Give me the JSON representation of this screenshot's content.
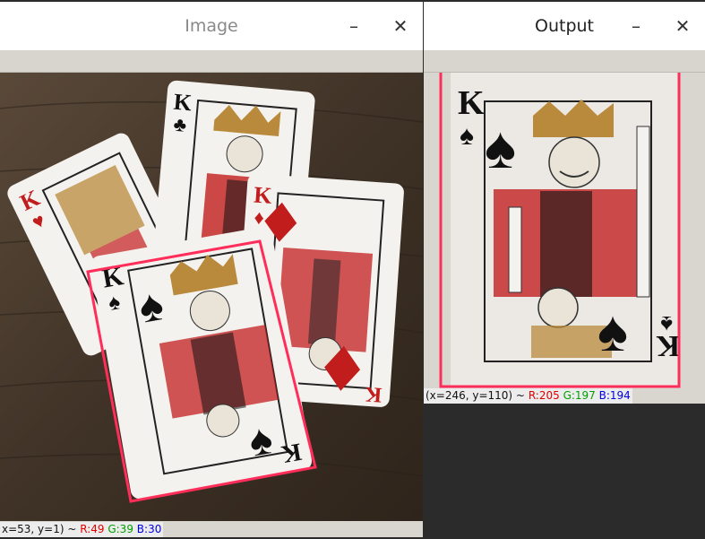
{
  "windows": {
    "image": {
      "title": "Image",
      "minimize": "–",
      "close": "✕",
      "status": {
        "coords": "x=53, y=1) ~",
        "r": "R:49",
        "g": "G:39",
        "b": "B:30"
      }
    },
    "output": {
      "title": "Output",
      "minimize": "–",
      "close": "✕",
      "status": {
        "coords": "(x=246, y=110) ~",
        "r": "R:205",
        "g": "G:197",
        "b": "B:194"
      }
    }
  },
  "cards": {
    "rank": "K",
    "suits": {
      "spade": "♠",
      "heart": "♥",
      "club": "♣",
      "diamond": "♦"
    }
  },
  "colors": {
    "table_wood": "#4a3b2e",
    "selection": "#ff2d5a",
    "card_red": "#c21d1d",
    "card_black": "#111111",
    "card_gold": "#b98a3c"
  },
  "icons": [
    "minimize-icon",
    "close-icon",
    "spade-icon",
    "heart-icon",
    "club-icon",
    "diamond-icon",
    "crown-icon"
  ]
}
